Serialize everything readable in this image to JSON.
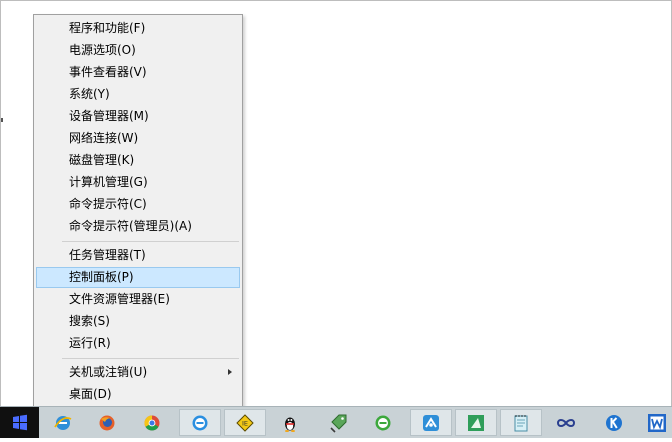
{
  "context_menu": {
    "items": [
      {
        "label": "程序和功能(F)"
      },
      {
        "label": "电源选项(O)"
      },
      {
        "label": "事件查看器(V)"
      },
      {
        "label": "系统(Y)"
      },
      {
        "label": "设备管理器(M)"
      },
      {
        "label": "网络连接(W)"
      },
      {
        "label": "磁盘管理(K)"
      },
      {
        "label": "计算机管理(G)"
      },
      {
        "label": "命令提示符(C)"
      },
      {
        "label": "命令提示符(管理员)(A)"
      },
      {
        "label": "任务管理器(T)"
      },
      {
        "label": "控制面板(P)"
      },
      {
        "label": "文件资源管理器(E)"
      },
      {
        "label": "搜索(S)"
      },
      {
        "label": "运行(R)"
      },
      {
        "label": "关机或注销(U)"
      },
      {
        "label": "桌面(D)"
      }
    ],
    "highlighted": "控制面板(P)"
  },
  "taskbar": {
    "start_button": {
      "icon": "windows-logo-icon"
    },
    "pinned_icons": [
      "internet-explorer-icon",
      "firefox-icon",
      "chrome-icon",
      "browser-e-icon",
      "ie-sign-icon",
      "qq-penguin-icon",
      "green-tag-icon",
      "green-browser-e-icon",
      "blue-app-icon",
      "green-app-icon",
      "notepad-icon",
      "infinity-icon",
      "k-app-icon",
      "wps-writer-icon"
    ]
  },
  "colors": {
    "menu_bg": "#f0f0f0",
    "highlight_bg": "#cce8ff",
    "highlight_border": "#99c9ef",
    "taskbar_bg": "#c9d2d6",
    "start_bg": "#101010"
  }
}
